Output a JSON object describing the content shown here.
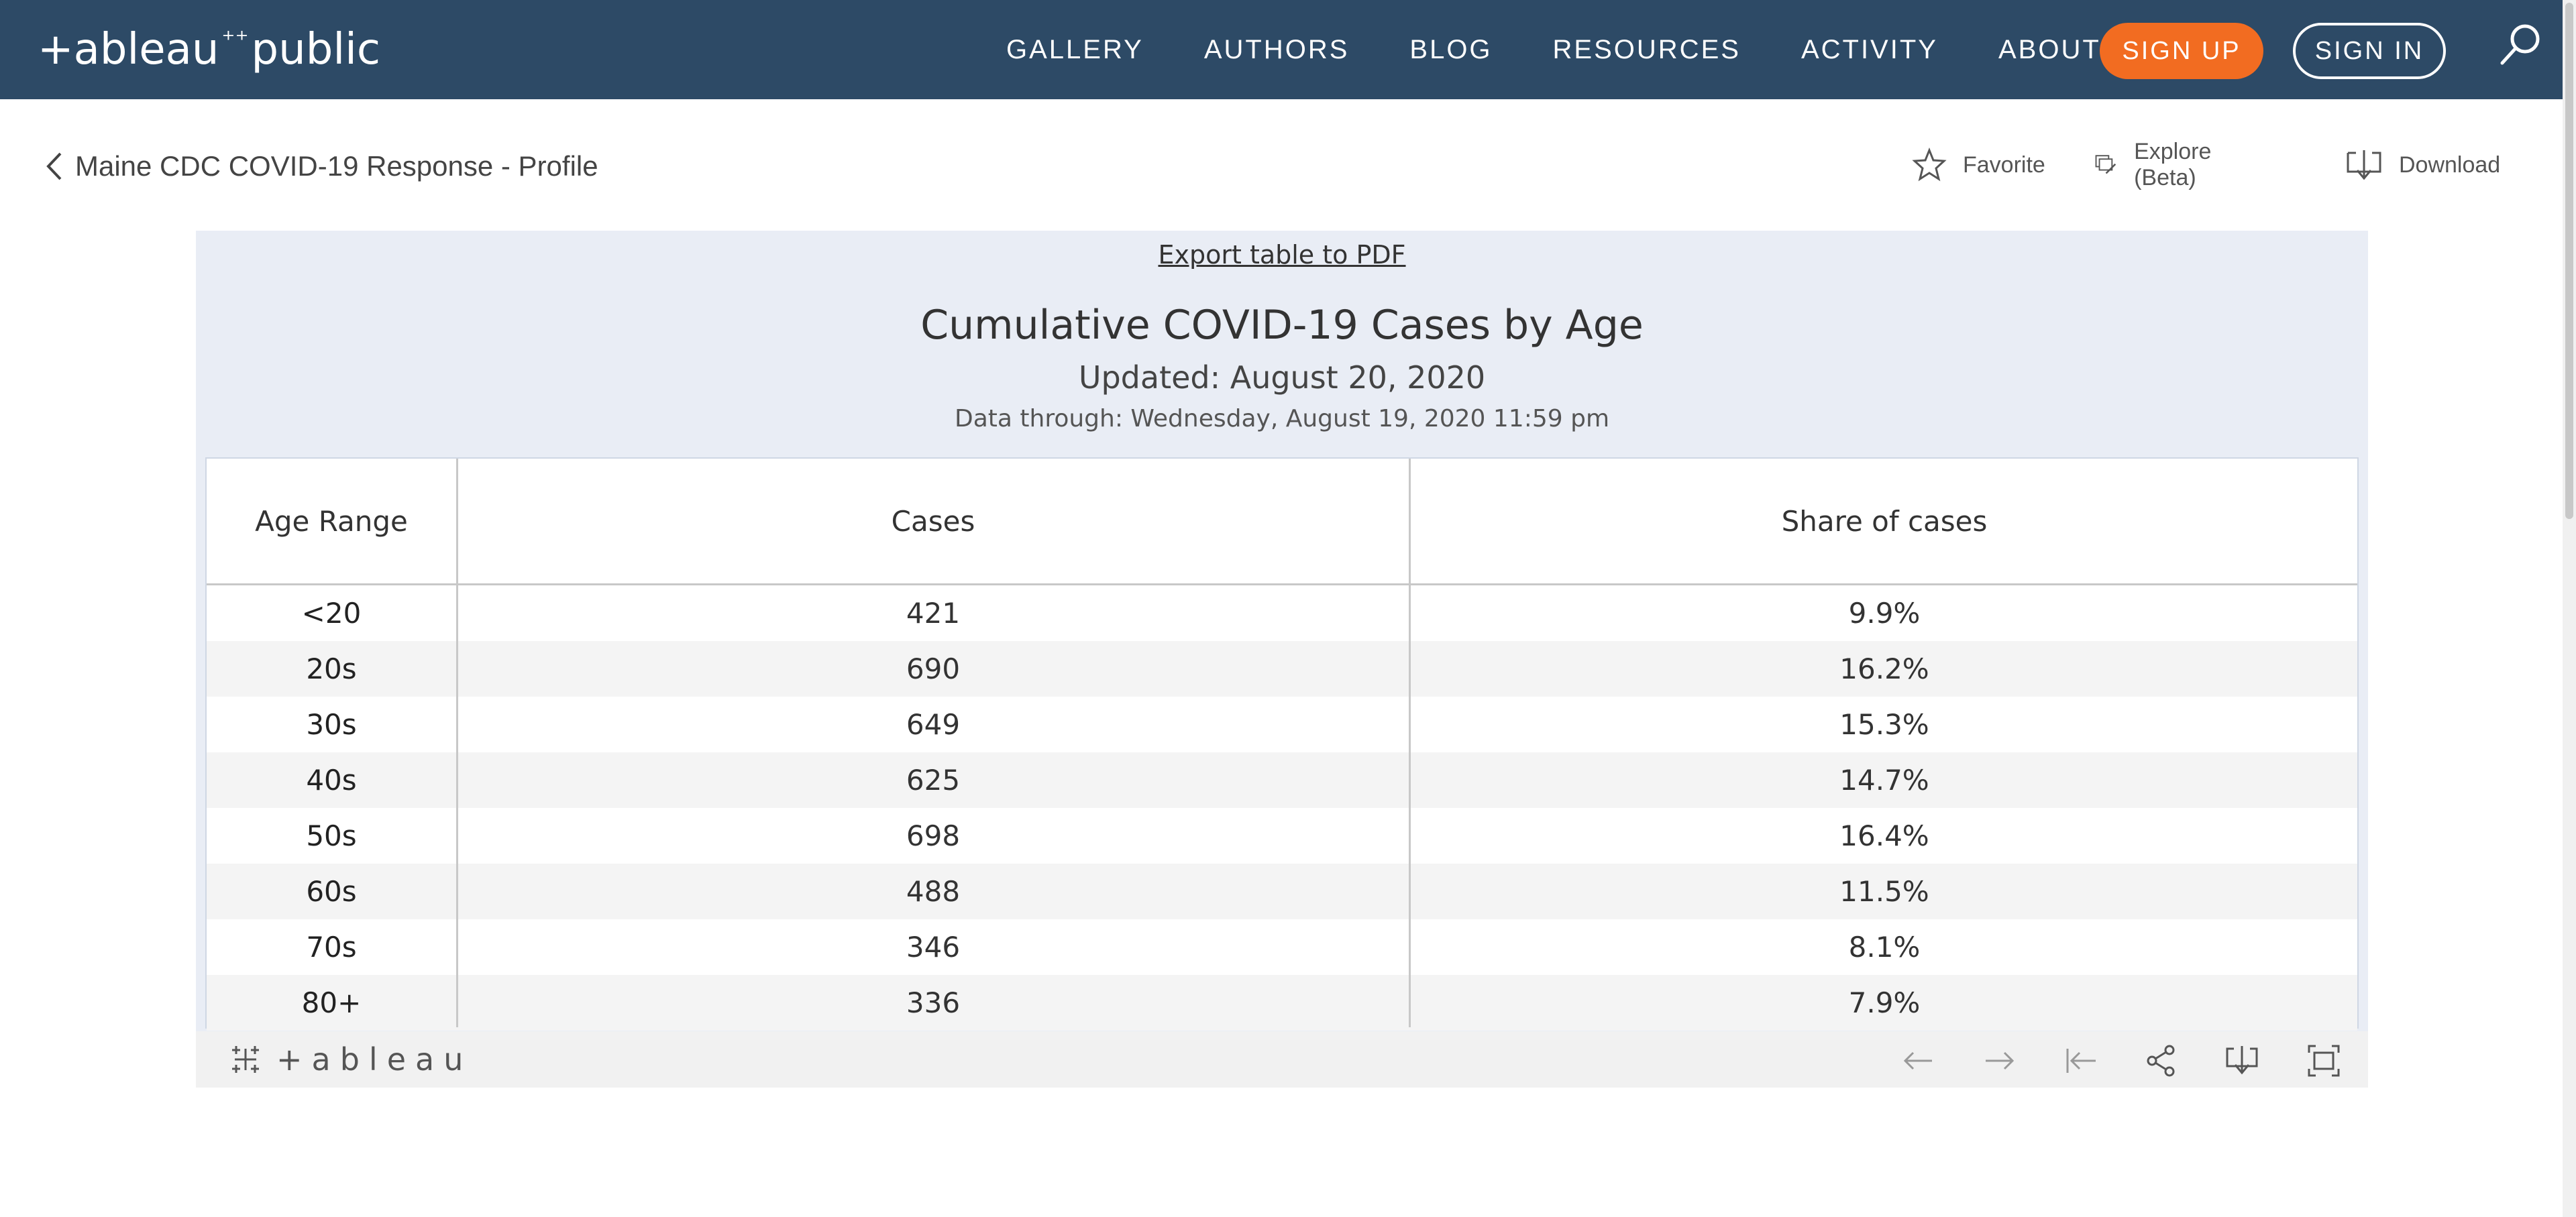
{
  "nav": {
    "logo_left": "+ableau",
    "logo_right": "public",
    "links": [
      "GALLERY",
      "AUTHORS",
      "BLOG",
      "RESOURCES",
      "ACTIVITY",
      "ABOUT"
    ],
    "signup_label": "SIGN UP",
    "signin_label": "SIGN IN",
    "bg_color": "#2d4a66",
    "signup_color": "#f26c21"
  },
  "subheader": {
    "back_label": "Maine CDC COVID-19 Response - Profile",
    "favorite_label": "Favorite",
    "explore_label": "Explore (Beta)",
    "download_label": "Download"
  },
  "viz": {
    "export_label": "Export table to PDF",
    "title": "Cumulative COVID-19 Cases by Age",
    "updated": "Updated: August 20, 2020",
    "data_through": "Data through: Wednesday, August 19, 2020 11:59 pm",
    "columns": [
      "Age Range",
      "Cases",
      "Share of cases"
    ],
    "rows": [
      {
        "age": "<20",
        "cases": "421",
        "share": "9.9%"
      },
      {
        "age": "20s",
        "cases": "690",
        "share": "16.2%"
      },
      {
        "age": "30s",
        "cases": "649",
        "share": "15.3%"
      },
      {
        "age": "40s",
        "cases": "625",
        "share": "14.7%"
      },
      {
        "age": "50s",
        "cases": "698",
        "share": "16.4%"
      },
      {
        "age": "60s",
        "cases": "488",
        "share": "11.5%"
      },
      {
        "age": "70s",
        "cases": "346",
        "share": "8.1%"
      },
      {
        "age": "80+",
        "cases": "336",
        "share": "7.9%"
      }
    ]
  },
  "toolbar": {
    "brand": "+ableau",
    "icons": [
      "undo-icon",
      "redo-icon",
      "revert-icon",
      "share-icon",
      "download-icon",
      "fullscreen-icon"
    ]
  }
}
